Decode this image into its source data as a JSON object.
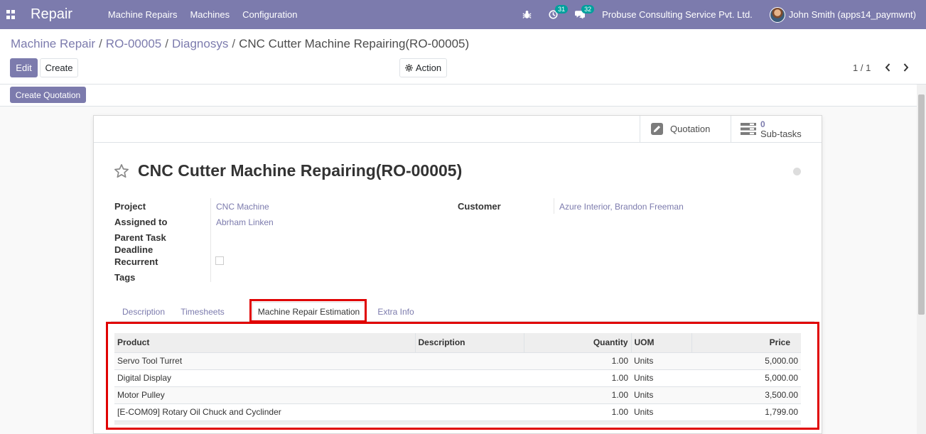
{
  "navbar": {
    "app_name": "Repair",
    "menu": [
      "Machine Repairs",
      "Machines",
      "Configuration"
    ],
    "activity_count": "31",
    "message_count": "32",
    "company": "Probuse Consulting Service Pvt. Ltd.",
    "user": "John Smith (apps14_paymwnt)"
  },
  "breadcrumb": {
    "items": [
      "Machine Repair",
      "RO-00005",
      "Diagnosys"
    ],
    "current": "CNC Cutter Machine Repairing(RO-00005)",
    "separator": "/"
  },
  "buttons": {
    "edit": "Edit",
    "create": "Create",
    "action": "Action",
    "create_quotation": "Create Quotation"
  },
  "pager": {
    "value": "1 / 1"
  },
  "smart_buttons": {
    "quotation": "Quotation",
    "subtasks_count": "0",
    "subtasks_label": "Sub-tasks"
  },
  "record": {
    "title": "CNC Cutter Machine Repairing(RO-00005)"
  },
  "fields": {
    "project_label": "Project",
    "project_value": "CNC Machine",
    "assigned_label": "Assigned to",
    "assigned_value": "Abrham Linken",
    "parent_task_label": "Parent Task",
    "deadline_label": "Deadline",
    "recurrent_label": "Recurrent",
    "tags_label": "Tags",
    "customer_label": "Customer",
    "customer_value": "Azure Interior, Brandon Freeman"
  },
  "tabs": [
    "Description",
    "Timesheets",
    "Machine Repair Estimation",
    "Extra Info"
  ],
  "table": {
    "headers": [
      "Product",
      "Description",
      "Quantity",
      "UOM",
      "Price"
    ],
    "rows": [
      [
        "Servo Tool Turret",
        "",
        "1.00",
        "Units",
        "5,000.00"
      ],
      [
        "Digital Display",
        "",
        "1.00",
        "Units",
        "5,000.00"
      ],
      [
        "Motor Pulley",
        "",
        "1.00",
        "Units",
        "3,500.00"
      ],
      [
        "[E-COM09] Rotary Oil Chuck and Cyclinder",
        "",
        "1.00",
        "Units",
        "1,799.00"
      ]
    ]
  },
  "colors": {
    "brand": "#7c7bad",
    "badge": "#00a09d",
    "highlight": "#e00000"
  }
}
